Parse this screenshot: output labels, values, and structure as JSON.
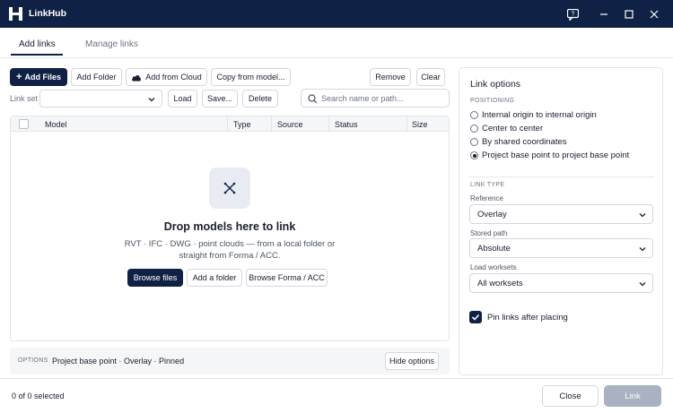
{
  "window": {
    "title": "LinkHub",
    "icons": [
      "app-logo-icon",
      "feedback-icon",
      "minimize-icon",
      "maximize-icon",
      "close-icon"
    ]
  },
  "tabs": [
    {
      "label": "Add links",
      "active": true
    },
    {
      "label": "Manage links",
      "active": false
    }
  ],
  "toolbar": {
    "add_files": "Add Files",
    "add_folder": "Add Folder",
    "add_from_cloud": "Add from Cloud",
    "copy_from_model": "Copy from model...",
    "remove": "Remove",
    "clear": "Clear"
  },
  "link_set": {
    "label": "Link set",
    "value": "",
    "load": "Load",
    "save": "Save...",
    "delete": "Delete"
  },
  "search": {
    "placeholder": "Search name or path..."
  },
  "table": {
    "columns": [
      "Model",
      "Type",
      "Source",
      "Status",
      "Size"
    ],
    "rows": []
  },
  "drop_zone": {
    "title": "Drop models here to link",
    "description_line1": "RVT · IFC · DWG · point clouds — from a local folder or",
    "description_line2": "straight from Forma / ACC.",
    "browse_files": "Browse files",
    "add_folder": "Add a folder",
    "browse_forma": "Browse Forma / ACC"
  },
  "options_bar": {
    "label": "OPTIONS",
    "summary": "Project base point · Overlay · Pinned",
    "hide_options": "Hide options"
  },
  "link_options": {
    "title": "Link options",
    "positioning_label": "POSITIONING",
    "positioning_options": [
      {
        "label": "Internal origin to internal origin",
        "selected": false
      },
      {
        "label": "Center to center",
        "selected": false
      },
      {
        "label": "By shared coordinates",
        "selected": false
      },
      {
        "label": "Project base point to project base point",
        "selected": true
      }
    ],
    "link_type_label": "LINK TYPE",
    "reference_label": "Reference",
    "reference_value": "Overlay",
    "stored_path_label": "Stored path",
    "stored_path_value": "Absolute",
    "load_worksets_label": "Load worksets",
    "load_worksets_value": "All worksets",
    "pin_links_label": "Pin links after placing",
    "pin_links_checked": true
  },
  "footer": {
    "status": "0 of 0 selected",
    "close": "Close",
    "link": "Link"
  },
  "colors": {
    "brand": "#0f2245",
    "disabled": "#a9b2c0"
  }
}
